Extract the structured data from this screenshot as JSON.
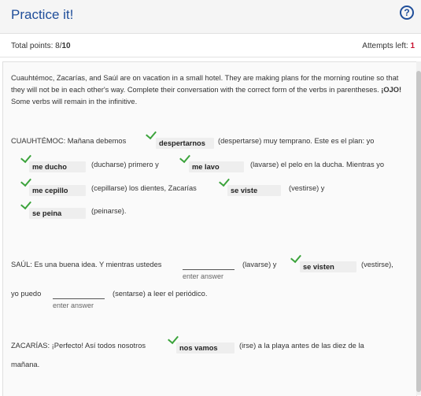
{
  "header": {
    "title": "Practice it!",
    "help_icon": "question-circle-icon"
  },
  "status": {
    "total_label": "Total points: 8/",
    "total_max": "10",
    "attempts_label": "Attempts left: ",
    "attempts_value": "1"
  },
  "intro": {
    "text": "Cuauhtémoc, Zacarías, and Saúl are on vacation in a small hotel. They are making plans for the morning routine so that they will not be in each other's way. Complete their conversation with the correct form of the verbs in parentheses. ",
    "ojo": "¡OJO!",
    "ojo_rest": " Some verbs will remain in the infinitive."
  },
  "c": {
    "l1a": "CUAUHTÉMOC: Mañana debemos",
    "a1": "despertarnos",
    "l1b": "(despertarse) muy temprano. Este es el plan: yo",
    "a2": "me ducho",
    "l2a": "(ducharse) primero y",
    "a3": "me lavo",
    "l2b": "(lavarse) el pelo en la ducha. Mientras yo",
    "a4": "me cepillo",
    "l3a": "(cepillarse) los dientes, Zacarías",
    "a5": "se viste",
    "l3b": "(vestirse) y",
    "a6": "se peina",
    "l4a": "(peinarse)."
  },
  "s": {
    "l1a": "SAÚL: Es una buena idea. Y mientras ustedes",
    "hint1": "enter answer",
    "l1b": "(lavarse) y",
    "a7": "se visten",
    "l1c": "(vestirse),",
    "l2a": "yo puedo",
    "hint2": "enter answer",
    "l2b": "(sentarse) a leer el periódico."
  },
  "z": {
    "l1a": "ZACARÍAS: ¡Perfecto! Así todos nosotros",
    "a8": "nos vamos",
    "l1b": "(irse) a la playa antes de las diez de la",
    "l2a": "mañana."
  },
  "colors": {
    "title": "#1f4e9a",
    "check": "#3ba33b",
    "attempts": "#c8102e"
  }
}
